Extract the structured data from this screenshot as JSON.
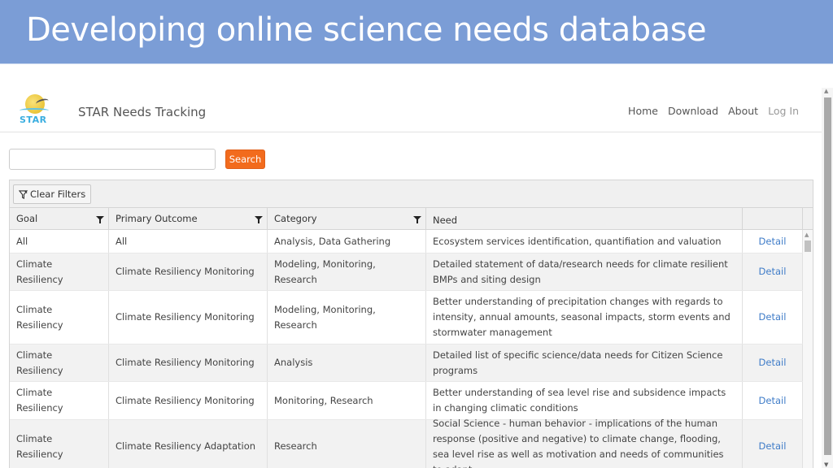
{
  "slide": {
    "title": "Developing online science needs database"
  },
  "app": {
    "logo_text": "STAR",
    "brand": "STAR Needs Tracking",
    "nav": [
      "Home",
      "Download",
      "About",
      "Log In"
    ],
    "search": {
      "value": "",
      "placeholder": "",
      "button": "Search"
    },
    "toolbar": {
      "clear_filters": "Clear Filters"
    },
    "columns": [
      "Goal",
      "Primary Outcome",
      "Category",
      "Need",
      ""
    ],
    "rows": [
      {
        "goal": "All",
        "outcome": "All",
        "category": "Analysis, Data Gathering",
        "need": "Ecosystem services identification, quantifiation and valuation",
        "action": "Detail"
      },
      {
        "goal": "Climate Resiliency",
        "outcome": "Climate Resiliency Monitoring",
        "category": "Modeling, Monitoring, Research",
        "need": "Detailed statement of data/research needs for climate resilient BMPs and siting design",
        "action": "Detail"
      },
      {
        "goal": "Climate Resiliency",
        "outcome": "Climate Resiliency Monitoring",
        "category": "Modeling, Monitoring, Research",
        "need": "Better understanding of precipitation changes with regards to intensity, annual amounts, seasonal impacts, storm events and stormwater management",
        "action": "Detail"
      },
      {
        "goal": "Climate Resiliency",
        "outcome": "Climate Resiliency Monitoring",
        "category": "Analysis",
        "need": "Detailed list of specific science/data needs for Citizen Science programs",
        "action": "Detail"
      },
      {
        "goal": "Climate Resiliency",
        "outcome": "Climate Resiliency Monitoring",
        "category": "Monitoring, Research",
        "need": "Better understanding of sea level rise and subsidence impacts in changing climatic conditions",
        "action": "Detail"
      },
      {
        "goal": "Climate Resiliency",
        "outcome": "Climate Resiliency Adaptation",
        "category": "Research",
        "need": "Social Science - human behavior - implications of the human response (positive and negative) to climate change, flooding, sea level rise as well as motivation and needs of communities to adapt",
        "action": "Detail"
      }
    ]
  }
}
